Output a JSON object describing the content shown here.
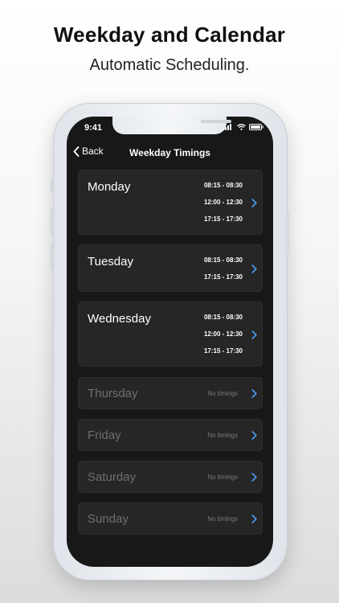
{
  "marketing": {
    "headline": "Weekday and Calendar",
    "subheadline": "Automatic Scheduling."
  },
  "status_bar": {
    "time": "9:41"
  },
  "nav": {
    "back_label": "Back",
    "title": "Weekday Timings"
  },
  "accent_color": "#4a9cf5",
  "days": [
    {
      "name": "Monday",
      "timings": [
        "08:15 - 08:30",
        "12:00 - 12:30",
        "17:15 - 17:30"
      ]
    },
    {
      "name": "Tuesday",
      "timings": [
        "08:15 - 08:30",
        "17:15 - 17:30"
      ]
    },
    {
      "name": "Wednesday",
      "timings": [
        "08:15 - 08:30",
        "12:00 - 12:30",
        "17:15 - 17:30"
      ]
    },
    {
      "name": "Thursday",
      "empty_label": "No timings"
    },
    {
      "name": "Friday",
      "empty_label": "No timings"
    },
    {
      "name": "Saturday",
      "empty_label": "No timings"
    },
    {
      "name": "Sunday",
      "empty_label": "No timings"
    }
  ]
}
